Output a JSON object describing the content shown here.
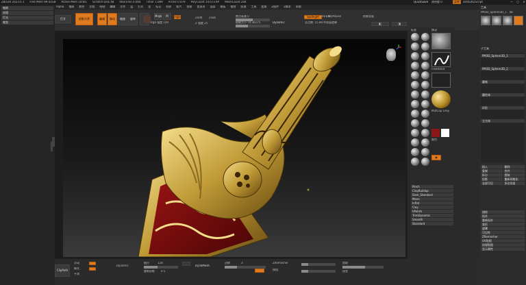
{
  "titlebar": {
    "status_items": [
      "ZBrush 2023.0.1",
      "Free Mem 99.01GB",
      "Active Mem 10561",
      "Scratch Disk 48",
      "RealTime 0.064",
      "Timer 1.089",
      "ATime 0.079",
      "PolyCount 14.673 KP",
      "MeshCount 204"
    ],
    "quicksave": "QuickSave",
    "see_through": "透明度 0",
    "menus_btn": "菜单",
    "script": "DefaultZScript"
  },
  "menubar": {
    "items": [
      "Alpha",
      "笔刷",
      "颜色",
      "文档",
      "绘制",
      "编辑",
      "文件",
      "层",
      "灯光",
      "宏",
      "标记",
      "材质",
      "影片",
      "拾取",
      "首选项",
      "渲染",
      "模板",
      "笔划",
      "纹理",
      "工具",
      "变换",
      "Z插件",
      "Z脚本",
      "帮助"
    ]
  },
  "left_panel": {
    "items": [
      {
        "label": "笔刷"
      },
      {
        "label": "纹理"
      },
      {
        "label": "灯光"
      },
      {
        "label": "笔划"
      }
    ]
  },
  "toolbar": {
    "load_project": "打开",
    "lightbox": "浏览",
    "projection": "投影大师",
    "mode_buttons": [
      "编辑",
      "移动",
      "缩放",
      "旋转"
    ],
    "mrgb": "Mrgb",
    "rgb": "Rgb",
    "m": "M",
    "zadd": "Zadd",
    "zsub": "Zsub",
    "rgb_intensity": "Rgb 强度 100",
    "z_intensity": "Z 强度 25",
    "focal_shift": "焦点衰减 0",
    "draw_size": "绘制大小 74.36175",
    "dynamic": "Dynamic",
    "active_points": "活动点数: 14.667 M",
    "total_points": "总点数: 15.89 M",
    "spotlight": "Spotlight",
    "lazymouse": "LazyMouse",
    "backface": "背面遮罩",
    "draw_help": "绘制背面"
  },
  "right_panel": {
    "title": "工具",
    "subtitle": "PM3D_Sphere3D_1 . 48",
    "subtool": "子工具",
    "sub_items": [
      "PM3D_Sphere3D_1",
      "PM3D_Sphere3D_2",
      "圆锥",
      "圆柱体",
      "环形",
      "立方体"
    ],
    "buttons": [
      "插入",
      "删除",
      "复制",
      "合并",
      "拆分",
      "提取",
      "投影",
      "重新网格化",
      "全部可见",
      "多边形组",
      "描绘",
      "拓扑",
      "重新拓扑",
      "变形",
      "遮罩",
      "可见性",
      "ZRemesher",
      "UV贴图",
      "纹理贴图",
      "显示属性"
    ]
  },
  "brush_panel": {
    "header_left": "标准",
    "header_right": "移动",
    "labels": [
      "Pinch",
      "ClayBuildup",
      "Dam_Standard",
      "Move",
      "Inflat",
      "Clay",
      "hPolish",
      "TrimDynamic",
      "Smooth",
      "Standard"
    ],
    "stroke_label": "FreeHand",
    "material_label": "MatCap Gray",
    "color_label": "颜色"
  },
  "bottom": {
    "clippath": "ClipPath",
    "labels": [
      "浮动",
      "模式",
      "平滑",
      "细分",
      "重新投影",
      "边缘"
    ],
    "values": [
      "128",
      "0.5",
      "3"
    ],
    "dynamesh": "DynaMesh",
    "zremesher": "ZRemesher",
    "group": "按组",
    "extract": "提取",
    "accept": "接受"
  }
}
